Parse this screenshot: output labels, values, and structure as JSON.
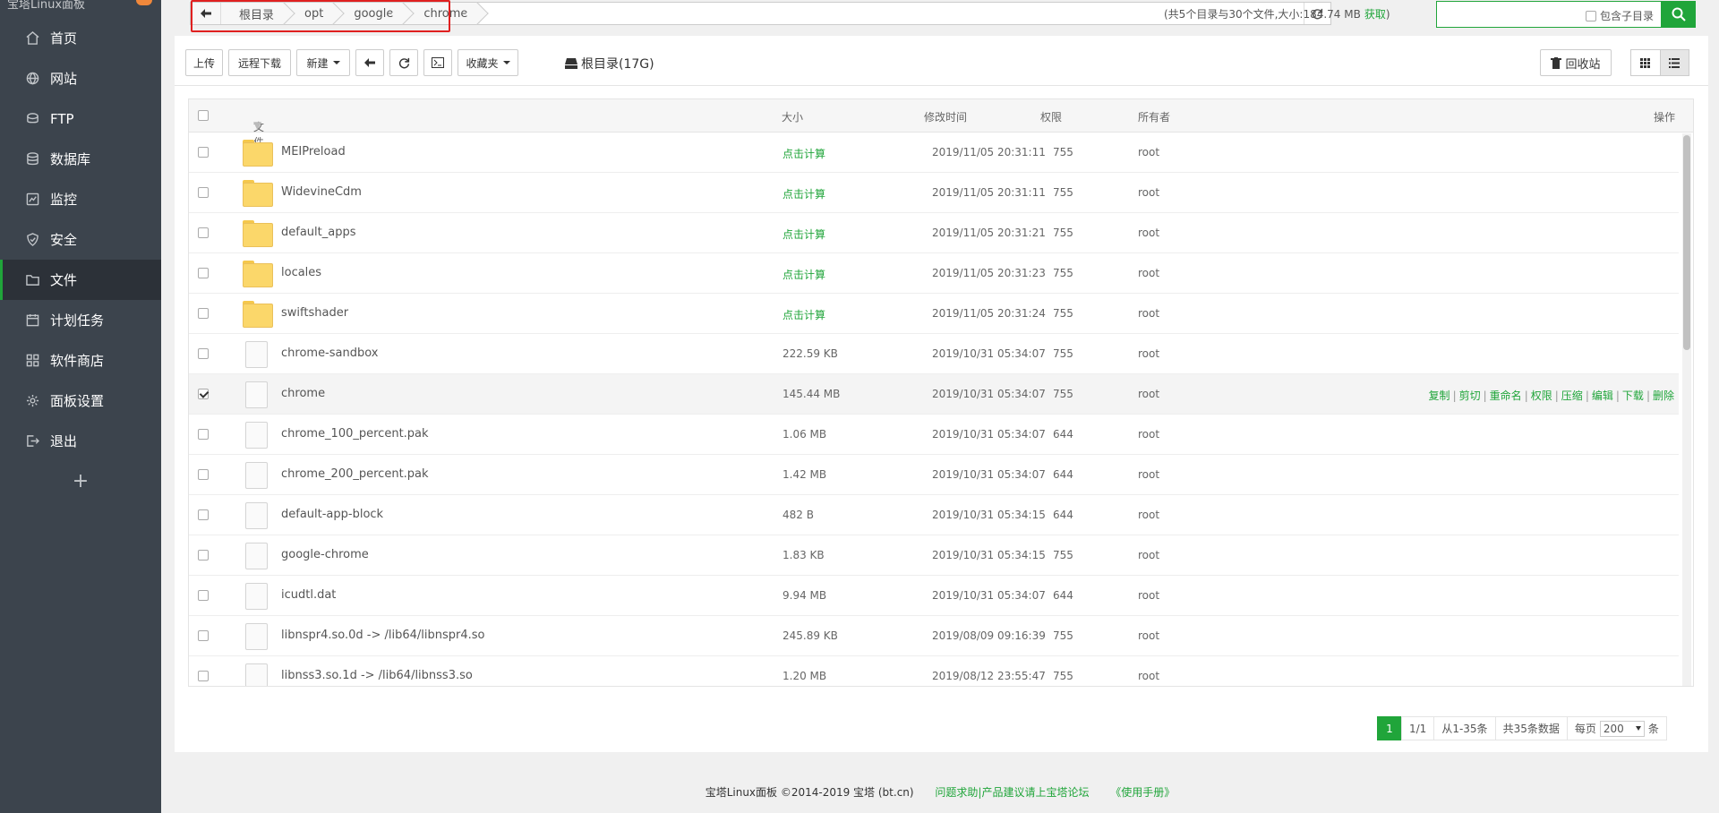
{
  "sidebar": {
    "logo_text": "宝塔Linux面板",
    "items": [
      {
        "label": "首页",
        "icon": "home-icon"
      },
      {
        "label": "网站",
        "icon": "globe-icon"
      },
      {
        "label": "FTP",
        "icon": "ftp-icon"
      },
      {
        "label": "数据库",
        "icon": "database-icon"
      },
      {
        "label": "监控",
        "icon": "monitor-icon"
      },
      {
        "label": "安全",
        "icon": "shield-icon"
      },
      {
        "label": "文件",
        "icon": "folder-icon",
        "active": true
      },
      {
        "label": "计划任务",
        "icon": "calendar-icon"
      },
      {
        "label": "软件商店",
        "icon": "apps-icon"
      },
      {
        "label": "面板设置",
        "icon": "gear-icon"
      },
      {
        "label": "退出",
        "icon": "logout-icon"
      }
    ],
    "add_label": "+"
  },
  "breadcrumb": {
    "items": [
      "根目录",
      "opt",
      "google",
      "chrome"
    ]
  },
  "size_info": {
    "text": "(共5个目录与30个文件,大小:184.74 MB",
    "fetch": "获取",
    "close": ")"
  },
  "search": {
    "include_sub": "包含子目录"
  },
  "toolbar": {
    "upload": "上传",
    "remote_download": "远程下载",
    "new": "新建",
    "favorites": "收藏夹",
    "disk": "根目录(17G)",
    "recycle": "回收站"
  },
  "table": {
    "headers": {
      "name": "文件名",
      "size": "大小",
      "mtime": "修改时间",
      "perm": "权限",
      "owner": "所有者",
      "actions": "操作"
    },
    "rows": [
      {
        "type": "folder",
        "name": "MEIPreload",
        "size": "点击计算",
        "mtime": "2019/11/05 20:31:11",
        "perm": "755",
        "owner": "root"
      },
      {
        "type": "folder",
        "name": "WidevineCdm",
        "size": "点击计算",
        "mtime": "2019/11/05 20:31:11",
        "perm": "755",
        "owner": "root"
      },
      {
        "type": "folder",
        "name": "default_apps",
        "size": "点击计算",
        "mtime": "2019/11/05 20:31:21",
        "perm": "755",
        "owner": "root"
      },
      {
        "type": "folder",
        "name": "locales",
        "size": "点击计算",
        "mtime": "2019/11/05 20:31:23",
        "perm": "755",
        "owner": "root"
      },
      {
        "type": "folder",
        "name": "swiftshader",
        "size": "点击计算",
        "mtime": "2019/11/05 20:31:24",
        "perm": "755",
        "owner": "root"
      },
      {
        "type": "file",
        "name": "chrome-sandbox",
        "size": "222.59 KB",
        "mtime": "2019/10/31 05:34:07",
        "perm": "755",
        "owner": "root"
      },
      {
        "type": "file",
        "name": "chrome",
        "size": "145.44 MB",
        "mtime": "2019/10/31 05:34:07",
        "perm": "755",
        "owner": "root",
        "selected": true
      },
      {
        "type": "file",
        "name": "chrome_100_percent.pak",
        "size": "1.06 MB",
        "mtime": "2019/10/31 05:34:07",
        "perm": "644",
        "owner": "root"
      },
      {
        "type": "file",
        "name": "chrome_200_percent.pak",
        "size": "1.42 MB",
        "mtime": "2019/10/31 05:34:07",
        "perm": "644",
        "owner": "root"
      },
      {
        "type": "file",
        "name": "default-app-block",
        "size": "482 B",
        "mtime": "2019/10/31 05:34:15",
        "perm": "644",
        "owner": "root"
      },
      {
        "type": "file",
        "name": "google-chrome",
        "size": "1.83 KB",
        "mtime": "2019/10/31 05:34:15",
        "perm": "755",
        "owner": "root"
      },
      {
        "type": "file",
        "name": "icudtl.dat",
        "size": "9.94 MB",
        "mtime": "2019/10/31 05:34:07",
        "perm": "644",
        "owner": "root"
      },
      {
        "type": "file",
        "name": "libnspr4.so.0d -> /lib64/libnspr4.so",
        "size": "245.89 KB",
        "mtime": "2019/08/09 09:16:39",
        "perm": "755",
        "owner": "root"
      },
      {
        "type": "file",
        "name": "libnss3.so.1d -> /lib64/libnss3.so",
        "size": "1.20 MB",
        "mtime": "2019/08/12 23:55:47",
        "perm": "755",
        "owner": "root"
      }
    ],
    "row_actions": [
      "复制",
      "剪切",
      "重命名",
      "权限",
      "压缩",
      "编辑",
      "下载",
      "删除"
    ]
  },
  "pager": {
    "current": "1",
    "pages": "1/1",
    "range": "从1-35条",
    "total": "共35条数据",
    "per_page_label": "每页",
    "per_page": "200",
    "unit": "条"
  },
  "footer": {
    "copyright": "宝塔Linux面板 ©2014-2019 宝塔 (bt.cn)",
    "forum": "问题求助|产品建议请上宝塔论坛",
    "manual": "《使用手册》"
  },
  "colors": {
    "accent": "#20a53a",
    "sidebar": "#3c444d",
    "highlight": "#e02020"
  }
}
